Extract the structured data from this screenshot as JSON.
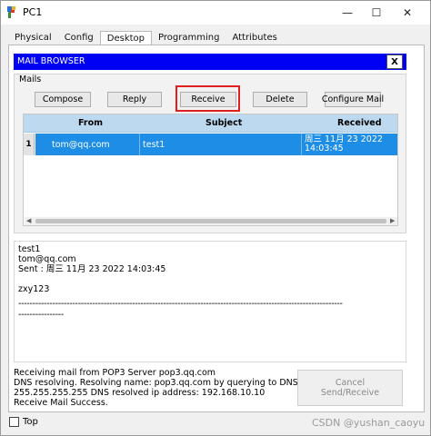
{
  "window": {
    "title": "PC1",
    "minimize": "—",
    "maximize": "☐",
    "close": "✕"
  },
  "tabs": [
    {
      "label": "Physical"
    },
    {
      "label": "Config"
    },
    {
      "label": "Desktop",
      "active": true
    },
    {
      "label": "Programming"
    },
    {
      "label": "Attributes"
    }
  ],
  "mail_browser": {
    "title": "MAIL BROWSER",
    "close": "X",
    "group_label": "Mails",
    "buttons": {
      "compose": "Compose",
      "reply": "Reply",
      "receive": "Receive",
      "delete": "Delete",
      "configure": "Configure Mail"
    },
    "columns": {
      "from": "From",
      "subject": "Subject",
      "received": "Received"
    },
    "rows": [
      {
        "index": "1",
        "from": "tom@qq.com",
        "subject": "test1",
        "received_line1": "周三 11月 23 2022",
        "received_line2": "14:03:45"
      }
    ],
    "scroll_left": "◀",
    "scroll_right": "▶"
  },
  "preview": {
    "subject": "test1",
    "from": "tom@qq.com",
    "sent": "Sent : 周三 11月 23 2022 14:03:45",
    "body": "zxy123",
    "divider1": "------------------------------------------------------------------------------------------------------------------",
    "divider2": "----------------"
  },
  "status": {
    "line1": "Receiving mail from POP3 Server pop3.qq.com",
    "line2": "DNS resolving. Resolving name: pop3.qq.com by querying to DNS Server:",
    "line3": "255.255.255.255  DNS resolved ip address: 192.168.10.10",
    "line4": "Receive Mail Success."
  },
  "send_receive": {
    "line1": "Cancel",
    "line2": "Send/Receive"
  },
  "top_checkbox": {
    "label": "Top"
  },
  "watermark": "CSDN @yushan_caoyu",
  "colors": {
    "title_bar": "#0000f5",
    "selection": "#1e8de6",
    "header": "#bcd9f0",
    "highlight": "#e02020"
  }
}
